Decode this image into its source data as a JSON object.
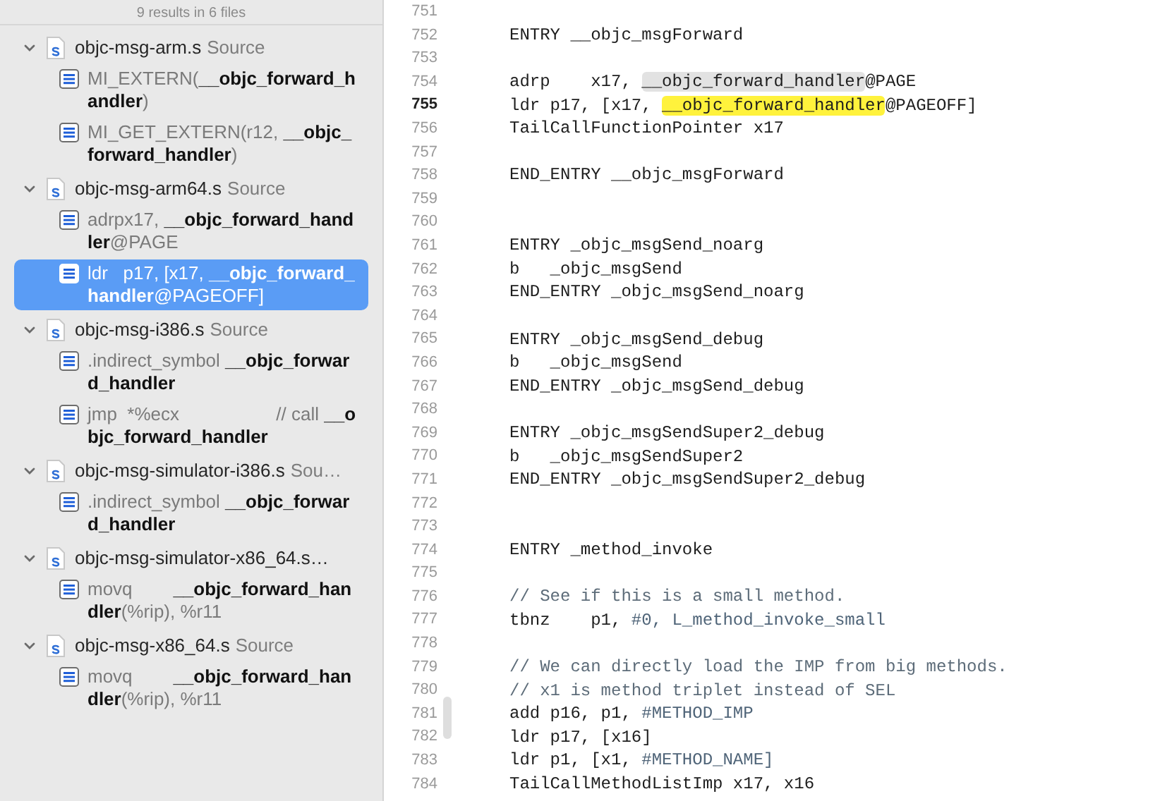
{
  "sidebar": {
    "summary": "9 results in 6 files",
    "files": [
      {
        "name": "objc-msg-arm.s",
        "type": "Source",
        "expanded": true,
        "matches": [
          {
            "selected": false,
            "parts": [
              {
                "text": "MI_EXTERN(",
                "bold": false
              },
              {
                "text": "__objc_forward_handler",
                "bold": true
              },
              {
                "text": ")",
                "bold": false
              }
            ]
          },
          {
            "selected": false,
            "parts": [
              {
                "text": "MI_GET_EXTERN(r12, ",
                "bold": false
              },
              {
                "text": "__objc_forward_handler",
                "bold": true
              },
              {
                "text": ")",
                "bold": false
              }
            ]
          }
        ]
      },
      {
        "name": "objc-msg-arm64.s",
        "type": "Source",
        "expanded": true,
        "matches": [
          {
            "selected": false,
            "parts": [
              {
                "text": "adrpx17, ",
                "bold": false
              },
              {
                "text": "__objc_forward_handler",
                "bold": true
              },
              {
                "text": "@PAGE",
                "bold": false
              }
            ]
          },
          {
            "selected": true,
            "parts": [
              {
                "text": "ldr   p17, [x17, ",
                "bold": false
              },
              {
                "text": "__objc_forward_handler",
                "bold": true
              },
              {
                "text": "@PAGEOFF]",
                "bold": false
              }
            ]
          }
        ]
      },
      {
        "name": "objc-msg-i386.s",
        "type": "Source",
        "expanded": true,
        "matches": [
          {
            "selected": false,
            "parts": [
              {
                "text": ".indirect_symbol ",
                "bold": false
              },
              {
                "text": "__objc_forward_handler",
                "bold": true
              }
            ]
          },
          {
            "selected": false,
            "parts": [
              {
                "text": "jmp  *%ecx                   // call ",
                "bold": false
              },
              {
                "text": "__objc_forward_handler",
                "bold": true
              }
            ]
          }
        ]
      },
      {
        "name": "objc-msg-simulator-i386.s",
        "type": "Sou…",
        "expanded": true,
        "matches": [
          {
            "selected": false,
            "parts": [
              {
                "text": ".indirect_symbol ",
                "bold": false
              },
              {
                "text": "__objc_forward_handler",
                "bold": true
              }
            ]
          }
        ]
      },
      {
        "name": "objc-msg-simulator-x86_64.s…",
        "expanded": true,
        "matches": [
          {
            "selected": false,
            "parts": [
              {
                "text": "movq        ",
                "bold": false
              },
              {
                "text": "__objc_forward_handler",
                "bold": true
              },
              {
                "text": "(%rip), %r11",
                "bold": false
              }
            ]
          }
        ]
      },
      {
        "name": "objc-msg-x86_64.s",
        "type": "Source",
        "expanded": true,
        "matches": [
          {
            "selected": false,
            "parts": [
              {
                "text": "movq        ",
                "bold": false
              },
              {
                "text": "__objc_forward_handler",
                "bold": true
              },
              {
                "text": "(%rip), %r11",
                "bold": false
              }
            ]
          }
        ]
      }
    ]
  },
  "editor": {
    "lines": [
      {
        "number": "751",
        "current": false
      },
      {
        "number": "752",
        "current": false,
        "segments": [
          {
            "text": "ENTRY __objc_msgForward",
            "kind": "plain"
          }
        ]
      },
      {
        "number": "753",
        "current": false
      },
      {
        "number": "754",
        "current": false,
        "segments": [
          {
            "text": "adrp    x17, ",
            "kind": "plain"
          },
          {
            "text": "__objc_forward_handler",
            "kind": "match"
          },
          {
            "text": "@PAGE",
            "kind": "plain"
          }
        ]
      },
      {
        "number": "755",
        "current": true,
        "segments": [
          {
            "text": "ldr p17, [x17, ",
            "kind": "plain"
          },
          {
            "text": "__objc_forward_handler",
            "kind": "current_match"
          },
          {
            "text": "@PAGEOFF]",
            "kind": "plain"
          }
        ]
      },
      {
        "number": "756",
        "current": false,
        "segments": [
          {
            "text": "TailCallFunctionPointer x17",
            "kind": "plain"
          }
        ]
      },
      {
        "number": "757",
        "current": false
      },
      {
        "number": "758",
        "current": false,
        "segments": [
          {
            "text": "END_ENTRY __objc_msgForward",
            "kind": "plain"
          }
        ]
      },
      {
        "number": "759",
        "current": false
      },
      {
        "number": "760",
        "current": false
      },
      {
        "number": "761",
        "current": false,
        "segments": [
          {
            "text": "ENTRY _objc_msgSend_noarg",
            "kind": "plain"
          }
        ]
      },
      {
        "number": "762",
        "current": false,
        "segments": [
          {
            "text": "b   _objc_msgSend",
            "kind": "plain"
          }
        ]
      },
      {
        "number": "763",
        "current": false,
        "segments": [
          {
            "text": "END_ENTRY _objc_msgSend_noarg",
            "kind": "plain"
          }
        ]
      },
      {
        "number": "764",
        "current": false
      },
      {
        "number": "765",
        "current": false,
        "segments": [
          {
            "text": "ENTRY _objc_msgSend_debug",
            "kind": "plain"
          }
        ]
      },
      {
        "number": "766",
        "current": false,
        "segments": [
          {
            "text": "b   _objc_msgSend",
            "kind": "plain"
          }
        ]
      },
      {
        "number": "767",
        "current": false,
        "segments": [
          {
            "text": "END_ENTRY _objc_msgSend_debug",
            "kind": "plain"
          }
        ]
      },
      {
        "number": "768",
        "current": false
      },
      {
        "number": "769",
        "current": false,
        "segments": [
          {
            "text": "ENTRY _objc_msgSendSuper2_debug",
            "kind": "plain"
          }
        ]
      },
      {
        "number": "770",
        "current": false,
        "segments": [
          {
            "text": "b   _objc_msgSendSuper2",
            "kind": "plain"
          }
        ]
      },
      {
        "number": "771",
        "current": false,
        "segments": [
          {
            "text": "END_ENTRY _objc_msgSendSuper2_debug",
            "kind": "plain"
          }
        ]
      },
      {
        "number": "772",
        "current": false
      },
      {
        "number": "773",
        "current": false
      },
      {
        "number": "774",
        "current": false,
        "segments": [
          {
            "text": "ENTRY _method_invoke",
            "kind": "plain"
          }
        ]
      },
      {
        "number": "775",
        "current": false
      },
      {
        "number": "776",
        "current": false,
        "segments": [
          {
            "text": "// See if this is a small method.",
            "kind": "comment"
          }
        ]
      },
      {
        "number": "777",
        "current": false,
        "segments": [
          {
            "text": "tbnz    p1, ",
            "kind": "plain"
          },
          {
            "text": "#0, L_method_invoke_small",
            "kind": "literal"
          }
        ]
      },
      {
        "number": "778",
        "current": false
      },
      {
        "number": "779",
        "current": false,
        "segments": [
          {
            "text": "// We can directly load the IMP from big methods.",
            "kind": "comment"
          }
        ]
      },
      {
        "number": "780",
        "current": false,
        "segments": [
          {
            "text": "// x1 is method triplet instead of SEL",
            "kind": "comment"
          }
        ]
      },
      {
        "number": "781",
        "current": false,
        "segments": [
          {
            "text": "add p16, p1, ",
            "kind": "plain"
          },
          {
            "text": "#METHOD_IMP",
            "kind": "literal"
          }
        ]
      },
      {
        "number": "782",
        "current": false,
        "segments": [
          {
            "text": "ldr p17, [x16]",
            "kind": "plain"
          }
        ]
      },
      {
        "number": "783",
        "current": false,
        "segments": [
          {
            "text": "ldr p1, [x1, ",
            "kind": "plain"
          },
          {
            "text": "#METHOD_NAME]",
            "kind": "literal"
          }
        ]
      },
      {
        "number": "784",
        "current": false,
        "segments": [
          {
            "text": "TailCallMethodListImp x17, x16",
            "kind": "plain"
          }
        ]
      }
    ]
  }
}
